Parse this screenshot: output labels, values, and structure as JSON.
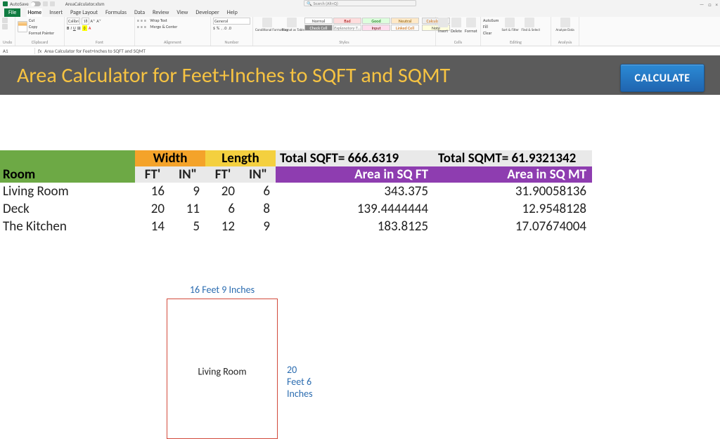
{
  "titlebar": {
    "autosave_label": "AutoSave",
    "doc_title": "AreaCalculator.xlsm",
    "search_placeholder": "Search (Alt+Q)",
    "win_min": "—",
    "win_max": "□",
    "win_close": "×"
  },
  "menutabs": {
    "file": "File",
    "items": [
      "Home",
      "Insert",
      "Page Layout",
      "Formulas",
      "Data",
      "Review",
      "View",
      "Developer",
      "Help"
    ],
    "active": "Home"
  },
  "ribbon": {
    "undo": "Undo",
    "group_undo": "Undo",
    "clipboard": {
      "paste": "Paste",
      "cut": "Cut",
      "copy": "Copy",
      "fp": "Format Painter",
      "label": "Clipboard"
    },
    "font": {
      "name": "Calibri",
      "size": "18",
      "label": "Font"
    },
    "alignment": {
      "wrap": "Wrap Text",
      "merge": "Merge & Center",
      "label": "Alignment"
    },
    "number": {
      "fmt": "General",
      "label": "Number"
    },
    "styles": {
      "cond": "Conditional Formatting",
      "fat": "Format as Table",
      "cells": [
        [
          "Normal",
          "Bad",
          "Good",
          "Neutral"
        ],
        [
          "Check Cell",
          "Explanatory T…",
          "Input",
          "Linked Cell"
        ]
      ],
      "extra": [
        "Calculation",
        "Note"
      ],
      "label": "Styles"
    },
    "cellsgrp": {
      "insert": "Insert",
      "delete": "Delete",
      "format": "Format",
      "label": "Cells"
    },
    "editing": {
      "sum": "AutoSum",
      "fill": "Fill",
      "clear": "Clear",
      "sort": "Sort & Filter",
      "find": "Find & Select",
      "label": "Editing"
    },
    "analysis": {
      "analyze": "Analyze Data",
      "label": "Analysis"
    }
  },
  "fxrow": {
    "namebox": "A1",
    "fx_label": "fx",
    "formula": "Area Calculator for Feet+Inches to SQFT and SQMT"
  },
  "sheet": {
    "title": "Area Calculator for Feet+Inches to SQFT and SQMT",
    "calc_btn": "CALCULATE",
    "width_h": "Width",
    "length_h": "Length",
    "total_sqft_label": "Total SQFT= 666.6319",
    "total_sqmt_label": "Total SQMT= 61.9321342",
    "room_h": "Room",
    "ft_h": "FT'",
    "in_h": "IN\"",
    "area_sqft_h": "Area in SQ FT",
    "area_sqmt_h": "Area in SQ MT",
    "rows": [
      {
        "name": "Living Room",
        "wft": "16",
        "win": "9",
        "lft": "20",
        "lin": "6",
        "sqft": "343.375",
        "sqmt": "31.90058136"
      },
      {
        "name": "Deck",
        "wft": "20",
        "win": "11",
        "lft": "6",
        "lin": "8",
        "sqft": "139.4444444",
        "sqmt": "12.9548128"
      },
      {
        "name": "The Kitchen",
        "wft": "14",
        "win": "5",
        "lft": "12",
        "lin": "9",
        "sqft": "183.8125",
        "sqmt": "17.07674004"
      }
    ],
    "diagram": {
      "top": "16 Feet 9 Inches",
      "side": "20 Feet 6 Inches",
      "name": "Living Room"
    }
  }
}
